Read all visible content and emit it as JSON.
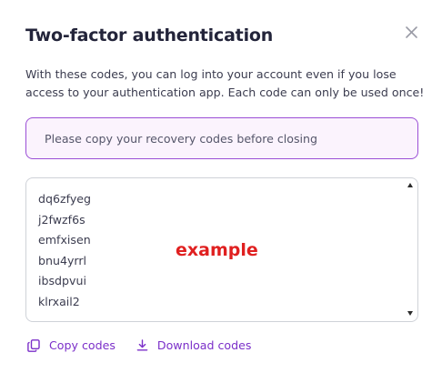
{
  "dialog": {
    "title": "Two-factor authentication",
    "description": "With these codes, you can log into your account even if you lose access to your authentication app. Each code can only be used once!",
    "notice": "Please copy your recovery codes before closing",
    "close_icon": "close-icon"
  },
  "codes": [
    "dq6zfyeg",
    "j2fwzf6s",
    "emfxisen",
    "bnu4yrrl",
    "ibsdpvui",
    "klrxail2"
  ],
  "watermark": "example",
  "actions": {
    "copy_label": "Copy codes",
    "copy_icon": "copy-icon",
    "download_label": "Download codes",
    "download_icon": "download-icon"
  },
  "colors": {
    "accent": "#7b2fc9",
    "notice_border": "#9b4fd6",
    "notice_background": "#fbf3fd",
    "watermark": "#e02020"
  }
}
